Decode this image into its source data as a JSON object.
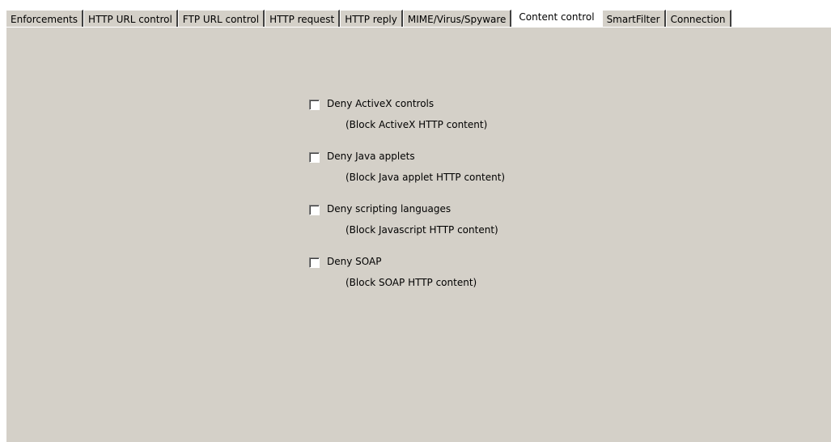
{
  "tabs": [
    {
      "label": "Enforcements",
      "active": false
    },
    {
      "label": "HTTP URL control",
      "active": false
    },
    {
      "label": "FTP URL control",
      "active": false
    },
    {
      "label": "HTTP request",
      "active": false
    },
    {
      "label": "HTTP reply",
      "active": false
    },
    {
      "label": "MIME/Virus/Spyware",
      "active": false
    },
    {
      "label": "Content control",
      "active": true
    },
    {
      "label": "SmartFilter",
      "active": false
    },
    {
      "label": "Connection",
      "active": false
    }
  ],
  "content": {
    "options": [
      {
        "label": "Deny ActiveX controls",
        "description": "(Block ActiveX HTTP content)",
        "checked": false
      },
      {
        "label": "Deny Java applets",
        "description": "(Block Java applet HTTP content)",
        "checked": false
      },
      {
        "label": "Deny scripting languages",
        "description": "(Block Javascript HTTP content)",
        "checked": false
      },
      {
        "label": "Deny SOAP",
        "description": "(Block SOAP HTTP content)",
        "checked": false
      }
    ]
  },
  "colors": {
    "panel_bg": "#d4d0c8",
    "active_tab_bg": "#ffffff"
  }
}
